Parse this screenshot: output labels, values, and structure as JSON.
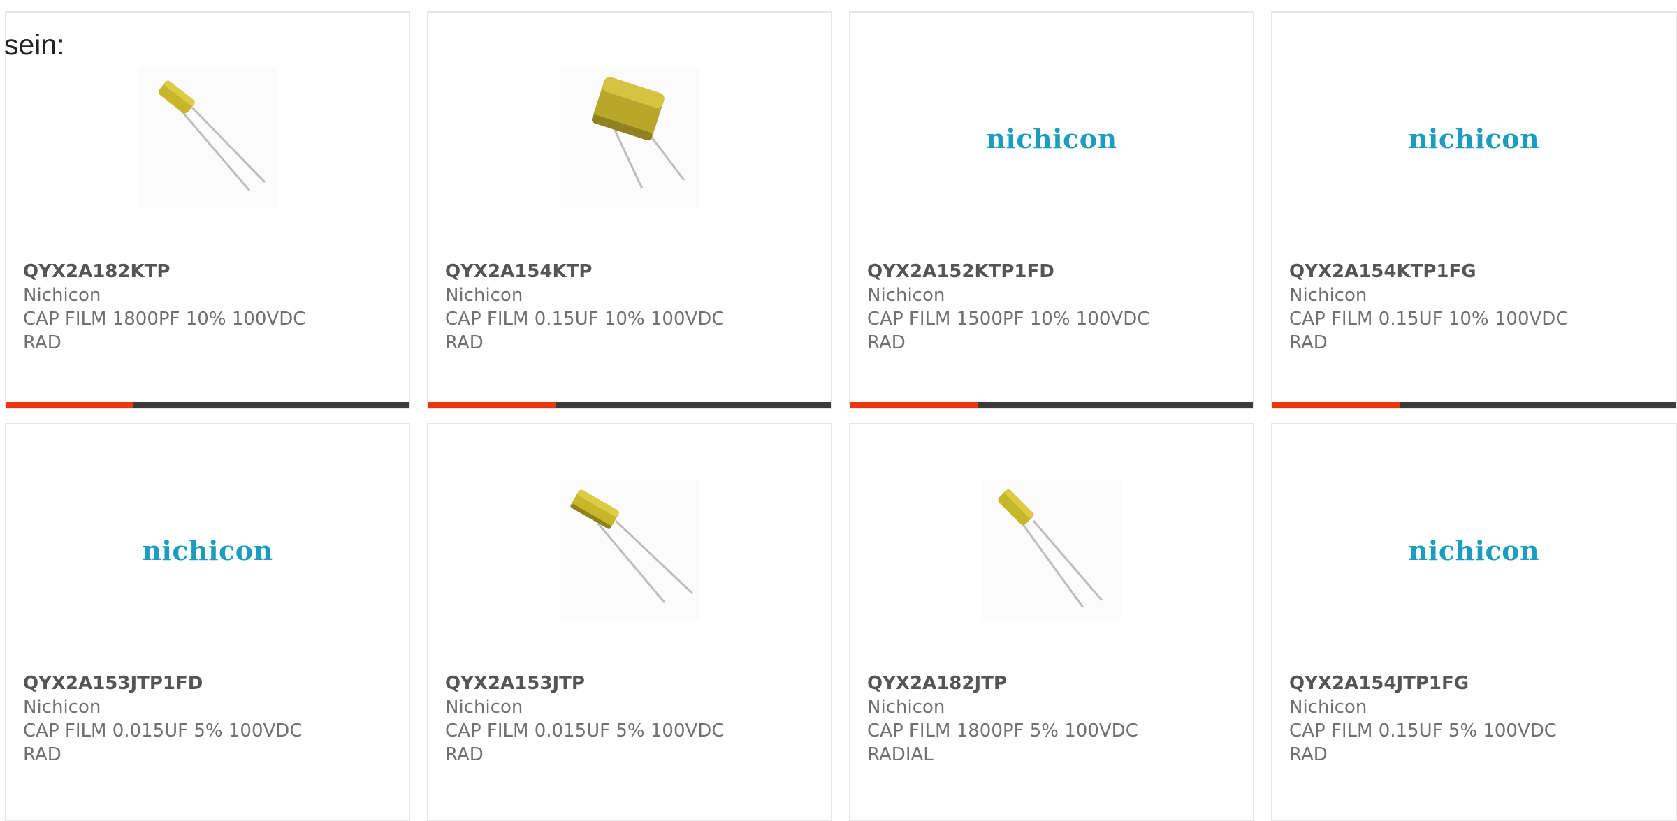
{
  "intro_text": "sein:",
  "colors": {
    "accent_bar": "#e8380d",
    "track_bar": "#3b3b3b",
    "logo": "#1c9dbf",
    "capacitor_body": "#c8b62a"
  },
  "products": [
    {
      "part": "QYX2A182KTP",
      "manufacturer": "Nichicon",
      "desc1": "CAP FILM 1800PF 10% 100VDC",
      "desc2": "RAD",
      "image": "capacitor-small",
      "logo_text": ""
    },
    {
      "part": "QYX2A154KTP",
      "manufacturer": "Nichicon",
      "desc1": "CAP FILM 0.15UF 10% 100VDC",
      "desc2": "RAD",
      "image": "capacitor-large",
      "logo_text": ""
    },
    {
      "part": "QYX2A152KTP1FD",
      "manufacturer": "Nichicon",
      "desc1": "CAP FILM 1500PF 10% 100VDC",
      "desc2": "RAD",
      "image": "nichicon-logo",
      "logo_text": "nichicon"
    },
    {
      "part": "QYX2A154KTP1FG",
      "manufacturer": "Nichicon",
      "desc1": "CAP FILM 0.15UF 10% 100VDC",
      "desc2": "RAD",
      "image": "nichicon-logo",
      "logo_text": "nichicon"
    },
    {
      "part": "QYX2A153JTP1FD",
      "manufacturer": "Nichicon",
      "desc1": "CAP FILM 0.015UF 5% 100VDC",
      "desc2": "RAD",
      "image": "nichicon-logo",
      "logo_text": "nichicon"
    },
    {
      "part": "QYX2A153JTP",
      "manufacturer": "Nichicon",
      "desc1": "CAP FILM 0.015UF 5% 100VDC",
      "desc2": "RAD",
      "image": "capacitor-medium",
      "logo_text": ""
    },
    {
      "part": "QYX2A182JTP",
      "manufacturer": "Nichicon",
      "desc1": "CAP FILM 1800PF 5% 100VDC",
      "desc2": "RADIAL",
      "image": "capacitor-small",
      "logo_text": ""
    },
    {
      "part": "QYX2A154JTP1FG",
      "manufacturer": "Nichicon",
      "desc1": "CAP FILM 0.15UF 5% 100VDC",
      "desc2": "RAD",
      "image": "nichicon-logo",
      "logo_text": "nichicon"
    }
  ]
}
